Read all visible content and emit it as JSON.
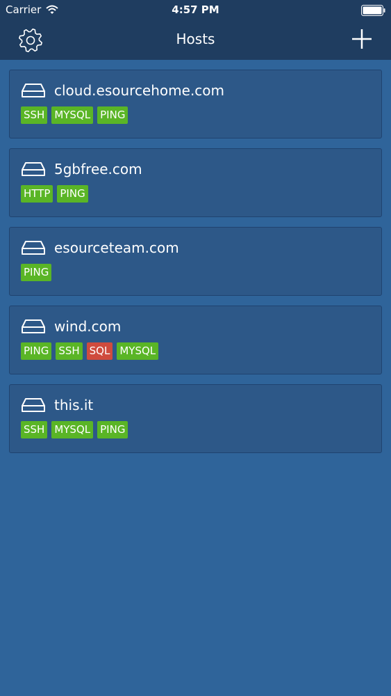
{
  "status_bar": {
    "carrier": "Carrier",
    "time": "4:57 PM"
  },
  "nav": {
    "title": "Hosts",
    "left_icon": "gear-icon",
    "right_icon": "plus-icon"
  },
  "colors": {
    "background": "#2f649a",
    "nav_background": "#1f3d60",
    "card_background": "#2d5888",
    "tag_green": "#5ab526",
    "tag_red": "#cf4b3e"
  },
  "hosts": [
    {
      "name": "cloud.esourcehome.com",
      "icon": "hard-drive-icon",
      "tags": [
        {
          "label": "SSH",
          "status": "ok"
        },
        {
          "label": "MYSQL",
          "status": "ok"
        },
        {
          "label": "PING",
          "status": "ok"
        }
      ]
    },
    {
      "name": "5gbfree.com",
      "icon": "hard-drive-icon",
      "tags": [
        {
          "label": "HTTP",
          "status": "ok"
        },
        {
          "label": "PING",
          "status": "ok"
        }
      ]
    },
    {
      "name": "esourceteam.com",
      "icon": "hard-drive-icon",
      "tags": [
        {
          "label": "PING",
          "status": "ok"
        }
      ]
    },
    {
      "name": "wind.com",
      "icon": "hard-drive-icon",
      "tags": [
        {
          "label": "PING",
          "status": "ok"
        },
        {
          "label": "SSH",
          "status": "ok"
        },
        {
          "label": "SQL",
          "status": "error"
        },
        {
          "label": "MYSQL",
          "status": "ok"
        }
      ]
    },
    {
      "name": "this.it",
      "icon": "hard-drive-icon",
      "tags": [
        {
          "label": "SSH",
          "status": "ok"
        },
        {
          "label": "MYSQL",
          "status": "ok"
        },
        {
          "label": "PING",
          "status": "ok"
        }
      ]
    }
  ]
}
